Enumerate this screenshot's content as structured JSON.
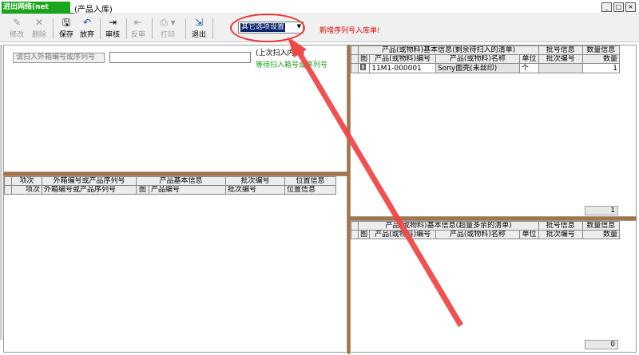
{
  "window": {
    "title": "_(产品入库)",
    "logo_text": "进出网络(net"
  },
  "window_controls": [
    "_",
    "□",
    "×"
  ],
  "toolbar": {
    "modify": "修改",
    "delete": "删除",
    "save": "保存",
    "abandon": "放弃",
    "review": "审核",
    "unreview": "反审",
    "print": "打印",
    "exit": "退出"
  },
  "options": {
    "selected": "其它选项设置"
  },
  "notice": "新增序列号入库单!",
  "scan": {
    "label": "请扫入外箱编号或序列号",
    "value": "",
    "last_scan": "(上次扫入内容)",
    "waiting": "等待扫入箱号或序列号"
  },
  "left_grid": {
    "group_headers": [
      "项次",
      "外箱编号或产品序列号",
      "产品基本信息",
      "批次编号",
      "位置信息"
    ],
    "columns": [
      "项次",
      "外箱编号或产品序列号",
      "图",
      "产品编号",
      "批次编号",
      "位置信息"
    ]
  },
  "right_top": {
    "group_headers": [
      "产品(或物料)基本信息(剩余待扫入的清单)",
      "批号信息",
      "数量信息"
    ],
    "columns": [
      "图",
      "产品(或物料)编号",
      "产品(或物料)名称",
      "单位",
      "批次编号",
      "数量"
    ],
    "rows": [
      {
        "code": "11M1-000001",
        "name": "Sony面壳(未丝印)",
        "unit": "个",
        "batch": "",
        "qty": "1"
      }
    ],
    "total": "1"
  },
  "right_bottom": {
    "group_headers": [
      "产品(或物料)基本信息(超量多余的清单)",
      "批号信息",
      "数量信息"
    ],
    "columns": [
      "图",
      "产品(或物料)编号",
      "产品(或物料)名称",
      "单位",
      "批次编号",
      "数量"
    ],
    "total": "0"
  }
}
